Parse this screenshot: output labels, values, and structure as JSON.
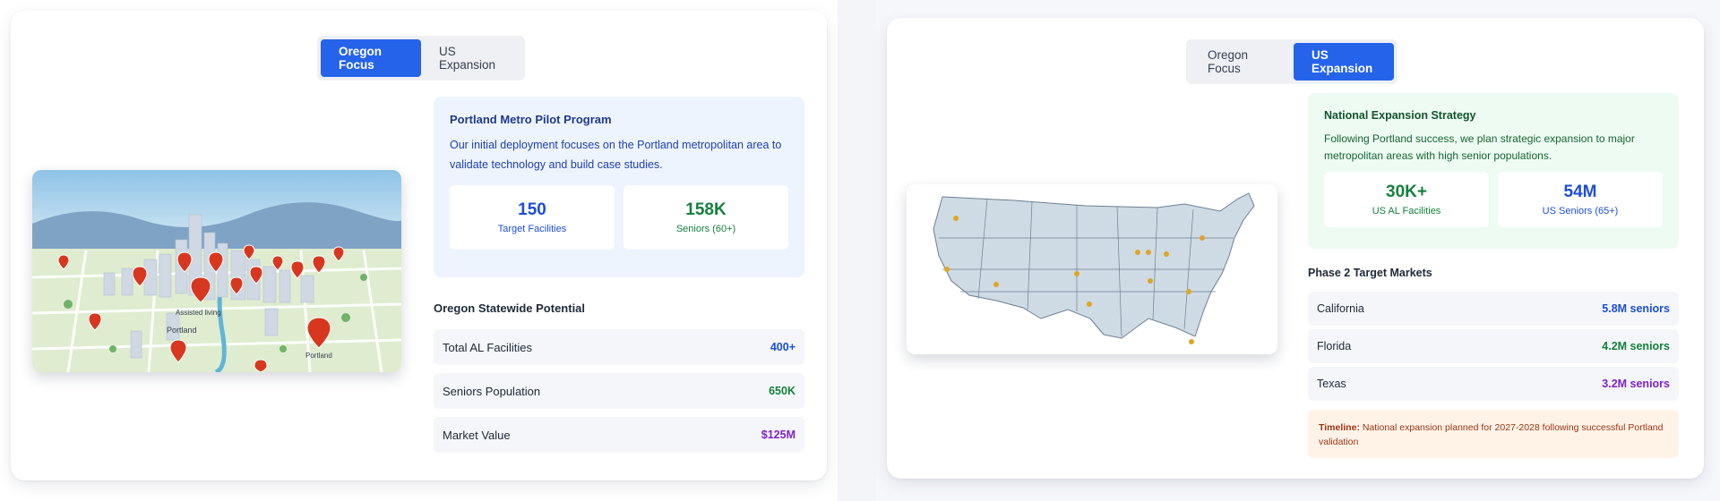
{
  "left": {
    "tabs": [
      {
        "label": "Oregon Focus",
        "active": true
      },
      {
        "label": "US Expansion",
        "active": false
      }
    ],
    "map_labels": {
      "assisted_living": "Assisted living",
      "portland1": "Portland",
      "portland2": "Portland"
    },
    "pilot": {
      "title": "Portland Metro Pilot Program",
      "text": "Our initial deployment focuses on the Portland metropolitan area to validate technology and build case studies.",
      "stats": [
        {
          "value": "150",
          "label": "Target Facilities",
          "color": "#1d4ed8"
        },
        {
          "value": "158K",
          "label": "Seniors (60+)",
          "color": "#15803d"
        }
      ]
    },
    "statewide": {
      "title": "Oregon Statewide Potential",
      "rows": [
        {
          "label": "Total AL Facilities",
          "value": "400+",
          "color": "#1d4ed8"
        },
        {
          "label": "Seniors Population",
          "value": "650K",
          "color": "#15803d"
        },
        {
          "label": "Market Value",
          "value": "$125M",
          "color": "#7e22ce"
        }
      ]
    }
  },
  "right": {
    "tabs": [
      {
        "label": "Oregon Focus",
        "active": false
      },
      {
        "label": "US Expansion",
        "active": true
      }
    ],
    "strategy": {
      "title": "National Expansion Strategy",
      "text": "Following Portland success, we plan strategic expansion to major metropolitan areas with high senior populations.",
      "stats": [
        {
          "value": "30K+",
          "label": "US AL Facilities",
          "color": "#15803d"
        },
        {
          "value": "54M",
          "label": "US Seniors (65+)",
          "color": "#1d4ed8"
        }
      ]
    },
    "markets": {
      "title": "Phase 2 Target Markets",
      "rows": [
        {
          "label": "California",
          "value": "5.8M seniors",
          "color": "#1d4ed8"
        },
        {
          "label": "Florida",
          "value": "4.2M seniors",
          "color": "#15803d"
        },
        {
          "label": "Texas",
          "value": "3.2M seniors",
          "color": "#7e22ce"
        }
      ]
    },
    "timeline": {
      "label": "Timeline:",
      "text": "National expansion planned for 2027-2028 following successful Portland validation"
    }
  }
}
